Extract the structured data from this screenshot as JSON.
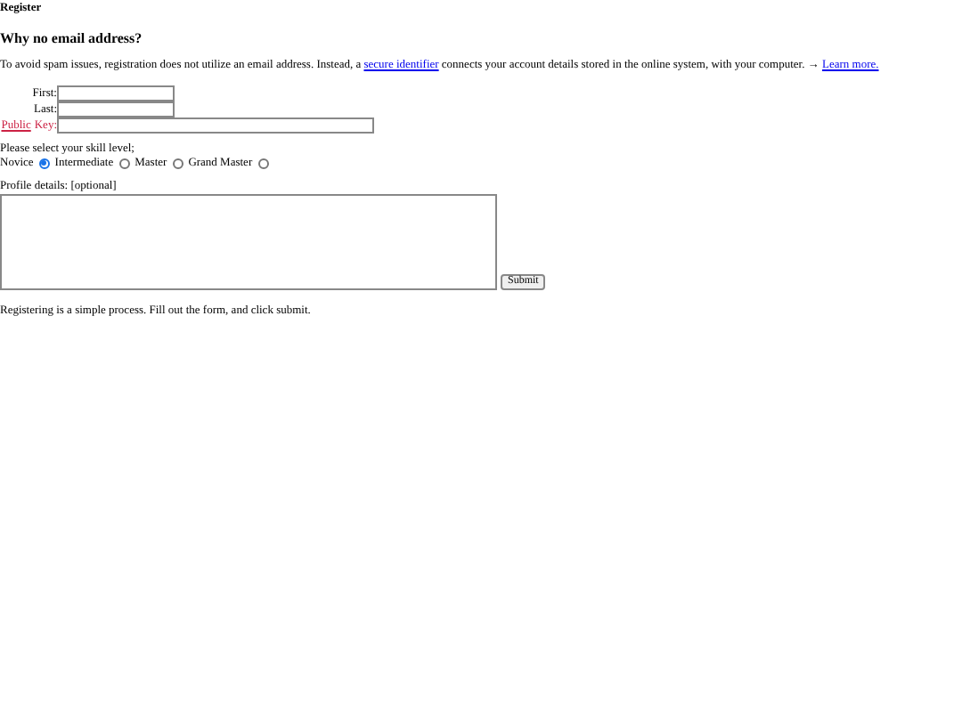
{
  "page_title": "Register",
  "heading": "Why no email address?",
  "intro": {
    "before": "To avoid spam issues, registration does not utilize an email address. Instead, a",
    "link": "secure identifier",
    "after": "connects your account details stored in the online system, with your computer. →",
    "learn_more": "Learn more."
  },
  "fields": [
    {
      "label": "First:",
      "kind": "short"
    },
    {
      "label": "Last:",
      "kind": "short"
    },
    {
      "label_link": "Public",
      "label": "Key:",
      "kind": "long"
    }
  ],
  "skill_prompt": "Please select your skill level;",
  "skills": [
    {
      "label": "Novice",
      "selected": true
    },
    {
      "label": "Intermediate",
      "selected": false
    },
    {
      "label": "Master",
      "selected": false
    },
    {
      "label": "Grand Master",
      "selected": false
    }
  ],
  "profile_label": "Profile details: [optional]",
  "submit": "Submit",
  "footer": "Registering is a simple process. Fill out the form, and click submit."
}
